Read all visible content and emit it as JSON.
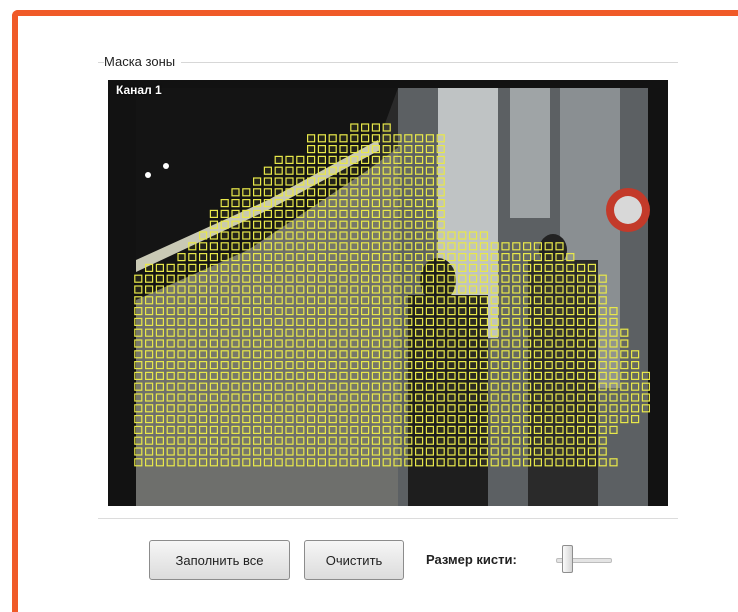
{
  "zone_mask": {
    "group_title": "Маска зоны",
    "channel_label": "Канал 1",
    "mask_color": "#e8e84a"
  },
  "controls": {
    "fill_all_label": "Заполнить все",
    "clear_label": "Очистить",
    "brush_size_label": "Размер кисти:",
    "brush_size_level": 0.15
  },
  "colors": {
    "frame_accent": "#f05a28",
    "mask_yellow": "#e8e84a"
  }
}
